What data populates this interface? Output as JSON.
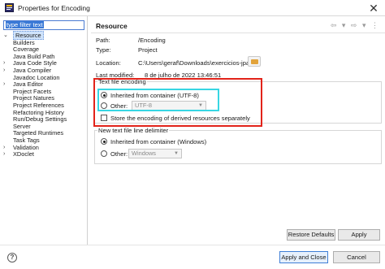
{
  "window": {
    "title": "Properties for Encoding",
    "close_glyph": "✕"
  },
  "sidebar": {
    "filter_placeholder": "type filter text",
    "items": [
      {
        "label": "Resource",
        "expandable": true,
        "selected": true
      },
      {
        "label": "Builders",
        "expandable": false
      },
      {
        "label": "Coverage",
        "expandable": false
      },
      {
        "label": "Java Build Path",
        "expandable": false
      },
      {
        "label": "Java Code Style",
        "expandable": true
      },
      {
        "label": "Java Compiler",
        "expandable": true
      },
      {
        "label": "Javadoc Location",
        "expandable": false
      },
      {
        "label": "Java Editor",
        "expandable": true
      },
      {
        "label": "Project Facets",
        "expandable": false
      },
      {
        "label": "Project Natures",
        "expandable": false
      },
      {
        "label": "Project References",
        "expandable": false
      },
      {
        "label": "Refactoring History",
        "expandable": false
      },
      {
        "label": "Run/Debug Settings",
        "expandable": false
      },
      {
        "label": "Server",
        "expandable": false
      },
      {
        "label": "Targeted Runtimes",
        "expandable": false
      },
      {
        "label": "Task Tags",
        "expandable": false
      },
      {
        "label": "Validation",
        "expandable": true
      },
      {
        "label": "XDoclet",
        "expandable": true
      }
    ]
  },
  "resource": {
    "title": "Resource",
    "nav_glyphs": "⇦ ▾ ⇨ ▾ ⋮",
    "path_label": "Path:",
    "path_value": "/Encoding",
    "type_label": "Type:",
    "type_value": "Project",
    "location_label": "Location:",
    "location_value": "C:\\Users\\geraf\\Downloads\\exercicios-jpa",
    "modified_label": "Last modified:",
    "modified_value": "8 de julho de 2022 13:46:51"
  },
  "text_encoding": {
    "group_label": "Text file encoding",
    "inherited_label": "Inherited from container (UTF-8)",
    "inherited_selected": true,
    "other_label": "Other:",
    "other_selected": false,
    "other_value": "UTF-8",
    "store_label": "Store the encoding of derived resources separately",
    "store_checked": false
  },
  "line_delimiter": {
    "group_label": "New text file line delimiter",
    "inherited_label": "Inherited from container (Windows)",
    "inherited_selected": true,
    "other_label": "Other:",
    "other_selected": false,
    "other_value": "Windows"
  },
  "buttons": {
    "restore_defaults": "Restore Defaults",
    "apply": "Apply",
    "apply_and_close": "Apply and Close",
    "cancel": "Cancel",
    "help": "?"
  },
  "colors": {
    "highlight_red": "#e2231a",
    "highlight_cyan": "#37d6e3",
    "selection_blue": "#cfe3fb"
  }
}
